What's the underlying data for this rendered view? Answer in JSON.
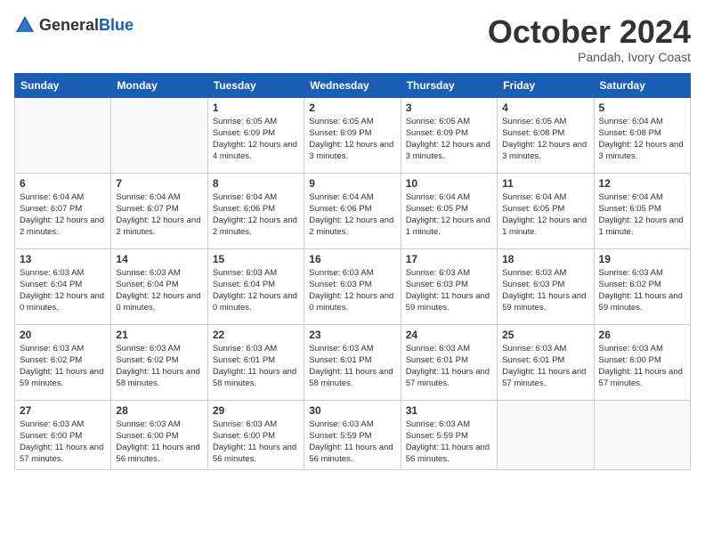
{
  "header": {
    "logo_general": "General",
    "logo_blue": "Blue",
    "month_title": "October 2024",
    "subtitle": "Pandah, Ivory Coast"
  },
  "weekdays": [
    "Sunday",
    "Monday",
    "Tuesday",
    "Wednesday",
    "Thursday",
    "Friday",
    "Saturday"
  ],
  "weeks": [
    [
      {
        "day": "",
        "info": ""
      },
      {
        "day": "",
        "info": ""
      },
      {
        "day": "1",
        "info": "Sunrise: 6:05 AM\nSunset: 6:09 PM\nDaylight: 12 hours and 4 minutes."
      },
      {
        "day": "2",
        "info": "Sunrise: 6:05 AM\nSunset: 6:09 PM\nDaylight: 12 hours and 3 minutes."
      },
      {
        "day": "3",
        "info": "Sunrise: 6:05 AM\nSunset: 6:09 PM\nDaylight: 12 hours and 3 minutes."
      },
      {
        "day": "4",
        "info": "Sunrise: 6:05 AM\nSunset: 6:08 PM\nDaylight: 12 hours and 3 minutes."
      },
      {
        "day": "5",
        "info": "Sunrise: 6:04 AM\nSunset: 6:08 PM\nDaylight: 12 hours and 3 minutes."
      }
    ],
    [
      {
        "day": "6",
        "info": "Sunrise: 6:04 AM\nSunset: 6:07 PM\nDaylight: 12 hours and 2 minutes."
      },
      {
        "day": "7",
        "info": "Sunrise: 6:04 AM\nSunset: 6:07 PM\nDaylight: 12 hours and 2 minutes."
      },
      {
        "day": "8",
        "info": "Sunrise: 6:04 AM\nSunset: 6:06 PM\nDaylight: 12 hours and 2 minutes."
      },
      {
        "day": "9",
        "info": "Sunrise: 6:04 AM\nSunset: 6:06 PM\nDaylight: 12 hours and 2 minutes."
      },
      {
        "day": "10",
        "info": "Sunrise: 6:04 AM\nSunset: 6:05 PM\nDaylight: 12 hours and 1 minute."
      },
      {
        "day": "11",
        "info": "Sunrise: 6:04 AM\nSunset: 6:05 PM\nDaylight: 12 hours and 1 minute."
      },
      {
        "day": "12",
        "info": "Sunrise: 6:04 AM\nSunset: 6:05 PM\nDaylight: 12 hours and 1 minute."
      }
    ],
    [
      {
        "day": "13",
        "info": "Sunrise: 6:03 AM\nSunset: 6:04 PM\nDaylight: 12 hours and 0 minutes."
      },
      {
        "day": "14",
        "info": "Sunrise: 6:03 AM\nSunset: 6:04 PM\nDaylight: 12 hours and 0 minutes."
      },
      {
        "day": "15",
        "info": "Sunrise: 6:03 AM\nSunset: 6:04 PM\nDaylight: 12 hours and 0 minutes."
      },
      {
        "day": "16",
        "info": "Sunrise: 6:03 AM\nSunset: 6:03 PM\nDaylight: 12 hours and 0 minutes."
      },
      {
        "day": "17",
        "info": "Sunrise: 6:03 AM\nSunset: 6:03 PM\nDaylight: 11 hours and 59 minutes."
      },
      {
        "day": "18",
        "info": "Sunrise: 6:03 AM\nSunset: 6:03 PM\nDaylight: 11 hours and 59 minutes."
      },
      {
        "day": "19",
        "info": "Sunrise: 6:03 AM\nSunset: 6:02 PM\nDaylight: 11 hours and 59 minutes."
      }
    ],
    [
      {
        "day": "20",
        "info": "Sunrise: 6:03 AM\nSunset: 6:02 PM\nDaylight: 11 hours and 59 minutes."
      },
      {
        "day": "21",
        "info": "Sunrise: 6:03 AM\nSunset: 6:02 PM\nDaylight: 11 hours and 58 minutes."
      },
      {
        "day": "22",
        "info": "Sunrise: 6:03 AM\nSunset: 6:01 PM\nDaylight: 11 hours and 58 minutes."
      },
      {
        "day": "23",
        "info": "Sunrise: 6:03 AM\nSunset: 6:01 PM\nDaylight: 11 hours and 58 minutes."
      },
      {
        "day": "24",
        "info": "Sunrise: 6:03 AM\nSunset: 6:01 PM\nDaylight: 11 hours and 57 minutes."
      },
      {
        "day": "25",
        "info": "Sunrise: 6:03 AM\nSunset: 6:01 PM\nDaylight: 11 hours and 57 minutes."
      },
      {
        "day": "26",
        "info": "Sunrise: 6:03 AM\nSunset: 6:00 PM\nDaylight: 11 hours and 57 minutes."
      }
    ],
    [
      {
        "day": "27",
        "info": "Sunrise: 6:03 AM\nSunset: 6:00 PM\nDaylight: 11 hours and 57 minutes."
      },
      {
        "day": "28",
        "info": "Sunrise: 6:03 AM\nSunset: 6:00 PM\nDaylight: 11 hours and 56 minutes."
      },
      {
        "day": "29",
        "info": "Sunrise: 6:03 AM\nSunset: 6:00 PM\nDaylight: 11 hours and 56 minutes."
      },
      {
        "day": "30",
        "info": "Sunrise: 6:03 AM\nSunset: 5:59 PM\nDaylight: 11 hours and 56 minutes."
      },
      {
        "day": "31",
        "info": "Sunrise: 6:03 AM\nSunset: 5:59 PM\nDaylight: 11 hours and 56 minutes."
      },
      {
        "day": "",
        "info": ""
      },
      {
        "day": "",
        "info": ""
      }
    ]
  ]
}
